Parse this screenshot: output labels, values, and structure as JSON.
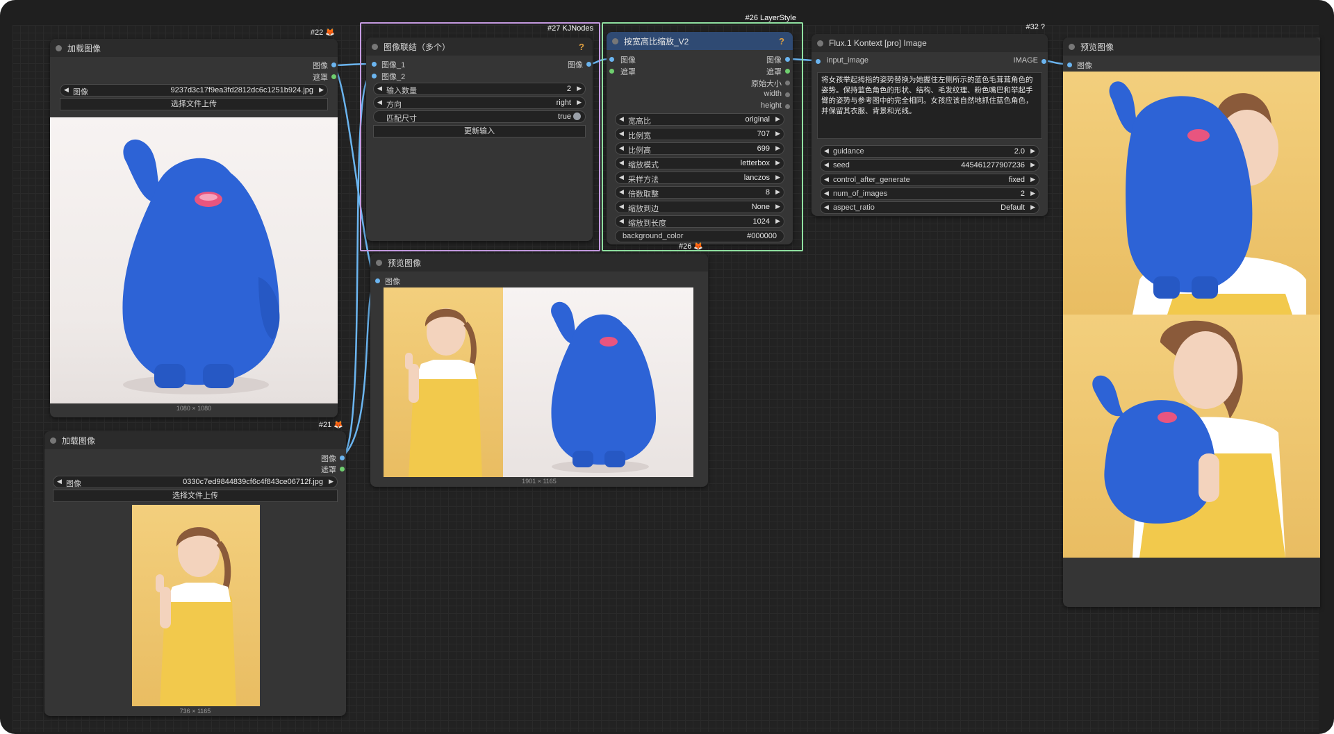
{
  "colors": {
    "wire_image": "#6bb5f0",
    "socket_mask": "#6fcf6f",
    "group_kj": "#c49ae0",
    "group_layerstyle": "#8fe0a0",
    "monster_blue": "#2d63d6",
    "dress_yellow": "#f2c94c",
    "backdrop_yellow": "#f0c872"
  },
  "nodes": {
    "load1": {
      "id": "#22",
      "title": "加载图像",
      "out_image": "图像",
      "out_mask": "遮罩",
      "widget_label": "图像",
      "filename": "9237d3c17f9ea3fd2812dc6c1251b924.jpg",
      "upload": "选择文件上传",
      "dims": "1080 × 1080"
    },
    "load2": {
      "id": "#21",
      "title": "加载图像",
      "out_image": "图像",
      "out_mask": "遮罩",
      "widget_label": "图像",
      "filename": "0330c7ed9844839cf6c4f843ce06712f.jpg",
      "upload": "选择文件上传",
      "dims": "736 × 1165"
    },
    "concat": {
      "group_label": "#27 KJNodes",
      "title": "图像联结（多个）",
      "in1": "图像_1",
      "in2": "图像_2",
      "out": "图像",
      "widgets": [
        {
          "label": "输入数量",
          "value": "2"
        },
        {
          "label": "方向",
          "value": "right"
        }
      ],
      "match_label": "匹配尺寸",
      "match_value": "true",
      "update_btn": "更新输入"
    },
    "preview_mid": {
      "title": "预览图像",
      "in": "图像",
      "dims": "1901 × 1165"
    },
    "resize": {
      "group_label": "#26 LayerStyle",
      "title": "按宽高比缩放_V2",
      "in_image": "图像",
      "in_mask": "遮罩",
      "outs": [
        "图像",
        "遮罩",
        "原始大小",
        "width",
        "height"
      ],
      "widgets": [
        {
          "label": "宽高比",
          "value": "original"
        },
        {
          "label": "比例宽",
          "value": "707"
        },
        {
          "label": "比例高",
          "value": "699"
        },
        {
          "label": "缩放模式",
          "value": "letterbox"
        },
        {
          "label": "采样方法",
          "value": "lanczos"
        },
        {
          "label": "倍数取整",
          "value": "8"
        },
        {
          "label": "缩放到边",
          "value": "None"
        },
        {
          "label": "缩放到长度",
          "value": "1024"
        }
      ],
      "bg_label": "background_color",
      "bg_value": "#000000",
      "footer_id": "#26"
    },
    "flux": {
      "id": "#32",
      "title": "Flux.1 Kontext [pro] Image",
      "in": "input_image",
      "out": "IMAGE",
      "prompt": "将女孩举起拇指的姿势替换为她握住左侧所示的蓝色毛茸茸角色的姿势。保持蓝色角色的形状、结构、毛发纹理、粉色嘴巴和举起手臂的姿势与参考图中的完全相同。女孩应该自然地抓住蓝色角色，并保留其衣服、背景和光线。",
      "widgets": [
        {
          "label": "guidance",
          "value": "2.0"
        },
        {
          "label": "seed",
          "value": "445461277907236"
        },
        {
          "label": "control_after_generate",
          "value": "fixed"
        },
        {
          "label": "num_of_images",
          "value": "2"
        },
        {
          "label": "aspect_ratio",
          "value": "Default"
        }
      ]
    },
    "preview_right": {
      "title": "预览图像",
      "in": "图像"
    }
  }
}
